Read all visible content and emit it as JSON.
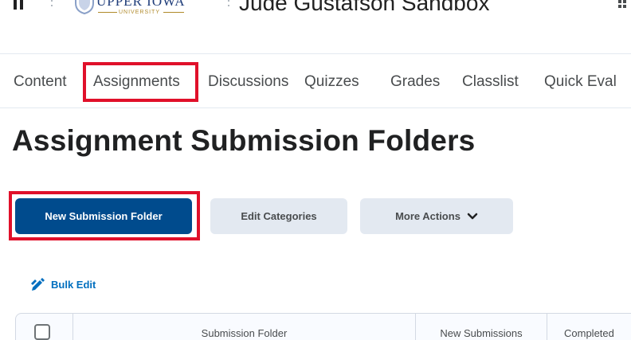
{
  "header": {
    "logo_word": "UPPER IOWA",
    "logo_sub": "UNIVERSITY",
    "course_title": "Jude Gustafson Sandbox"
  },
  "nav": {
    "items": [
      "Content",
      "Assignments",
      "Discussions",
      "Quizzes",
      "Grades",
      "Classlist",
      "Quick Eval"
    ]
  },
  "page": {
    "title": "Assignment Submission Folders"
  },
  "toolbar": {
    "new_folder_label": "New Submission Folder",
    "edit_categories_label": "Edit Categories",
    "more_actions_label": "More Actions"
  },
  "bulk_edit": {
    "label": "Bulk Edit"
  },
  "table": {
    "headers": [
      "Submission Folder",
      "New Submissions",
      "Completed"
    ]
  },
  "colors": {
    "primary_button": "#004b8d",
    "secondary_button": "#e3e9f1",
    "highlight_box": "#e0102a",
    "link": "#006fbf"
  }
}
